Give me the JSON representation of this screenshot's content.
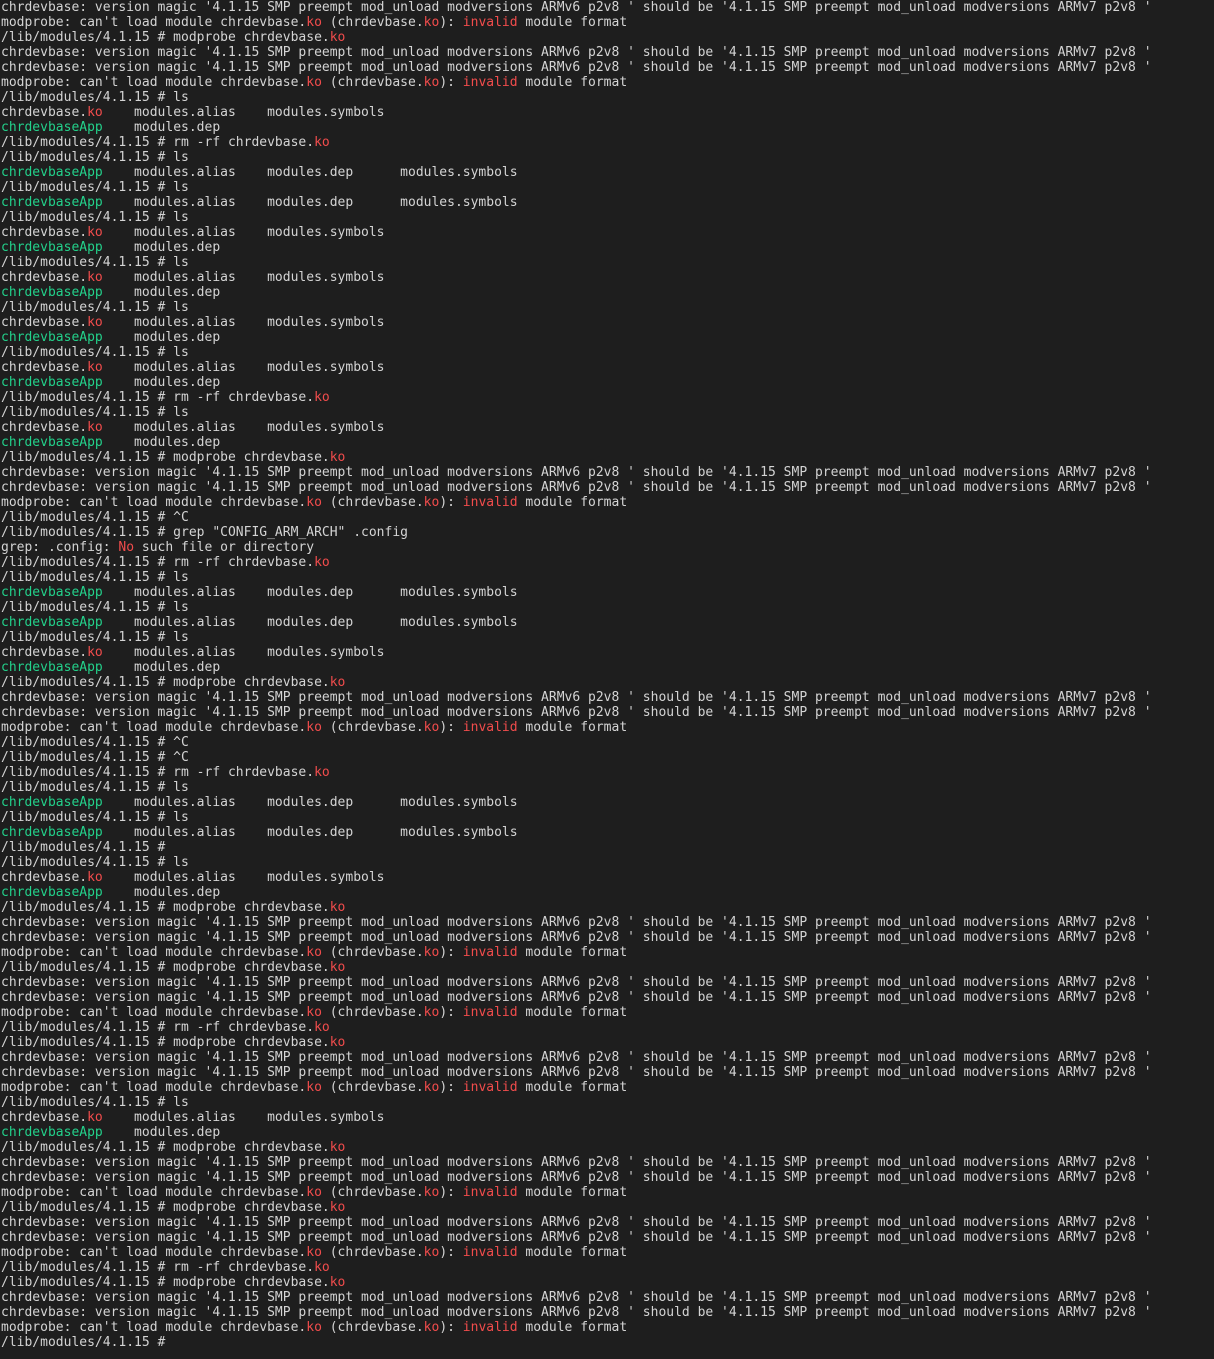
{
  "terminal": {
    "colors": {
      "background": "#1e1e1e",
      "foreground": "#d4d4d4",
      "ko_extension": "#f14c4c",
      "executable": "#23d18b",
      "error": "#f14c4c"
    },
    "lines": [
      [
        [
          "chrdevbase: version magic '4.1.15 SMP preempt mod_unload modversions ARMv6 p2v8 ' should be '4.1.15 SMP preempt mod_unload modversions ARMv7 p2v8 '",
          ""
        ]
      ],
      [
        [
          "modprobe: can't load module chrdevbase.",
          ""
        ],
        [
          "ko",
          "ko"
        ],
        [
          " (chrdevbase.",
          ""
        ],
        [
          "ko",
          "ko"
        ],
        [
          "): ",
          ""
        ],
        [
          "invalid",
          "err"
        ],
        [
          " module format",
          ""
        ]
      ],
      [
        [
          "/lib/modules/4.1.15 # modprobe chrdevbase.",
          ""
        ],
        [
          "ko",
          "ko"
        ]
      ],
      [
        [
          "chrdevbase: version magic '4.1.15 SMP preempt mod_unload modversions ARMv6 p2v8 ' should be '4.1.15 SMP preempt mod_unload modversions ARMv7 p2v8 '",
          ""
        ]
      ],
      [
        [
          "chrdevbase: version magic '4.1.15 SMP preempt mod_unload modversions ARMv6 p2v8 ' should be '4.1.15 SMP preempt mod_unload modversions ARMv7 p2v8 '",
          ""
        ]
      ],
      [
        [
          "modprobe: can't load module chrdevbase.",
          ""
        ],
        [
          "ko",
          "ko"
        ],
        [
          " (chrdevbase.",
          ""
        ],
        [
          "ko",
          "ko"
        ],
        [
          "): ",
          ""
        ],
        [
          "invalid",
          "err"
        ],
        [
          " module format",
          ""
        ]
      ],
      [
        [
          "/lib/modules/4.1.15 # ls",
          ""
        ]
      ],
      [
        [
          "chrdevbase.",
          ""
        ],
        [
          "ko",
          "ko"
        ],
        [
          "    modules.alias    modules.symbols",
          ""
        ]
      ],
      [
        [
          "chrdevbaseApp",
          "app"
        ],
        [
          "    modules.dep",
          ""
        ]
      ],
      [
        [
          "/lib/modules/4.1.15 # rm -rf chrdevbase.",
          ""
        ],
        [
          "ko",
          "ko"
        ]
      ],
      [
        [
          "/lib/modules/4.1.15 # ls",
          ""
        ]
      ],
      [
        [
          "chrdevbaseApp",
          "app"
        ],
        [
          "    modules.alias    modules.dep      modules.symbols",
          ""
        ]
      ],
      [
        [
          "/lib/modules/4.1.15 # ls",
          ""
        ]
      ],
      [
        [
          "chrdevbaseApp",
          "app"
        ],
        [
          "    modules.alias    modules.dep      modules.symbols",
          ""
        ]
      ],
      [
        [
          "/lib/modules/4.1.15 # ls",
          ""
        ]
      ],
      [
        [
          "chrdevbase.",
          ""
        ],
        [
          "ko",
          "ko"
        ],
        [
          "    modules.alias    modules.symbols",
          ""
        ]
      ],
      [
        [
          "chrdevbaseApp",
          "app"
        ],
        [
          "    modules.dep",
          ""
        ]
      ],
      [
        [
          "/lib/modules/4.1.15 # ls",
          ""
        ]
      ],
      [
        [
          "chrdevbase.",
          ""
        ],
        [
          "ko",
          "ko"
        ],
        [
          "    modules.alias    modules.symbols",
          ""
        ]
      ],
      [
        [
          "chrdevbaseApp",
          "app"
        ],
        [
          "    modules.dep",
          ""
        ]
      ],
      [
        [
          "/lib/modules/4.1.15 # ls",
          ""
        ]
      ],
      [
        [
          "chrdevbase.",
          ""
        ],
        [
          "ko",
          "ko"
        ],
        [
          "    modules.alias    modules.symbols",
          ""
        ]
      ],
      [
        [
          "chrdevbaseApp",
          "app"
        ],
        [
          "    modules.dep",
          ""
        ]
      ],
      [
        [
          "/lib/modules/4.1.15 # ls",
          ""
        ]
      ],
      [
        [
          "chrdevbase.",
          ""
        ],
        [
          "ko",
          "ko"
        ],
        [
          "    modules.alias    modules.symbols",
          ""
        ]
      ],
      [
        [
          "chrdevbaseApp",
          "app"
        ],
        [
          "    modules.dep",
          ""
        ]
      ],
      [
        [
          "/lib/modules/4.1.15 # rm -rf chrdevbase.",
          ""
        ],
        [
          "ko",
          "ko"
        ]
      ],
      [
        [
          "/lib/modules/4.1.15 # ls",
          ""
        ]
      ],
      [
        [
          "chrdevbase.",
          ""
        ],
        [
          "ko",
          "ko"
        ],
        [
          "    modules.alias    modules.symbols",
          ""
        ]
      ],
      [
        [
          "chrdevbaseApp",
          "app"
        ],
        [
          "    modules.dep",
          ""
        ]
      ],
      [
        [
          "/lib/modules/4.1.15 # modprobe chrdevbase.",
          ""
        ],
        [
          "ko",
          "ko"
        ]
      ],
      [
        [
          "chrdevbase: version magic '4.1.15 SMP preempt mod_unload modversions ARMv6 p2v8 ' should be '4.1.15 SMP preempt mod_unload modversions ARMv7 p2v8 '",
          ""
        ]
      ],
      [
        [
          "chrdevbase: version magic '4.1.15 SMP preempt mod_unload modversions ARMv6 p2v8 ' should be '4.1.15 SMP preempt mod_unload modversions ARMv7 p2v8 '",
          ""
        ]
      ],
      [
        [
          "modprobe: can't load module chrdevbase.",
          ""
        ],
        [
          "ko",
          "ko"
        ],
        [
          " (chrdevbase.",
          ""
        ],
        [
          "ko",
          "ko"
        ],
        [
          "): ",
          ""
        ],
        [
          "invalid",
          "err"
        ],
        [
          " module format",
          ""
        ]
      ],
      [
        [
          "/lib/modules/4.1.15 # ^C",
          ""
        ]
      ],
      [
        [
          "/lib/modules/4.1.15 # grep \"CONFIG_ARM_ARCH\" .config",
          ""
        ]
      ],
      [
        [
          "grep: .config: ",
          ""
        ],
        [
          "No",
          "err"
        ],
        [
          " such file or directory",
          ""
        ]
      ],
      [
        [
          "/lib/modules/4.1.15 # rm -rf chrdevbase.",
          ""
        ],
        [
          "ko",
          "ko"
        ]
      ],
      [
        [
          "/lib/modules/4.1.15 # ls",
          ""
        ]
      ],
      [
        [
          "chrdevbaseApp",
          "app"
        ],
        [
          "    modules.alias    modules.dep      modules.symbols",
          ""
        ]
      ],
      [
        [
          "/lib/modules/4.1.15 # ls",
          ""
        ]
      ],
      [
        [
          "chrdevbaseApp",
          "app"
        ],
        [
          "    modules.alias    modules.dep      modules.symbols",
          ""
        ]
      ],
      [
        [
          "/lib/modules/4.1.15 # ls",
          ""
        ]
      ],
      [
        [
          "chrdevbase.",
          ""
        ],
        [
          "ko",
          "ko"
        ],
        [
          "    modules.alias    modules.symbols",
          ""
        ]
      ],
      [
        [
          "chrdevbaseApp",
          "app"
        ],
        [
          "    modules.dep",
          ""
        ]
      ],
      [
        [
          "/lib/modules/4.1.15 # modprobe chrdevbase.",
          ""
        ],
        [
          "ko",
          "ko"
        ]
      ],
      [
        [
          "chrdevbase: version magic '4.1.15 SMP preempt mod_unload modversions ARMv6 p2v8 ' should be '4.1.15 SMP preempt mod_unload modversions ARMv7 p2v8 '",
          ""
        ]
      ],
      [
        [
          "chrdevbase: version magic '4.1.15 SMP preempt mod_unload modversions ARMv6 p2v8 ' should be '4.1.15 SMP preempt mod_unload modversions ARMv7 p2v8 '",
          ""
        ]
      ],
      [
        [
          "modprobe: can't load module chrdevbase.",
          ""
        ],
        [
          "ko",
          "ko"
        ],
        [
          " (chrdevbase.",
          ""
        ],
        [
          "ko",
          "ko"
        ],
        [
          "): ",
          ""
        ],
        [
          "invalid",
          "err"
        ],
        [
          " module format",
          ""
        ]
      ],
      [
        [
          "/lib/modules/4.1.15 # ^C",
          ""
        ]
      ],
      [
        [
          "/lib/modules/4.1.15 # ^C",
          ""
        ]
      ],
      [
        [
          "/lib/modules/4.1.15 # rm -rf chrdevbase.",
          ""
        ],
        [
          "ko",
          "ko"
        ]
      ],
      [
        [
          "/lib/modules/4.1.15 # ls",
          ""
        ]
      ],
      [
        [
          "chrdevbaseApp",
          "app"
        ],
        [
          "    modules.alias    modules.dep      modules.symbols",
          ""
        ]
      ],
      [
        [
          "/lib/modules/4.1.15 # ls",
          ""
        ]
      ],
      [
        [
          "chrdevbaseApp",
          "app"
        ],
        [
          "    modules.alias    modules.dep      modules.symbols",
          ""
        ]
      ],
      [
        [
          "/lib/modules/4.1.15 #",
          ""
        ]
      ],
      [
        [
          "/lib/modules/4.1.15 # ls",
          ""
        ]
      ],
      [
        [
          "chrdevbase.",
          ""
        ],
        [
          "ko",
          "ko"
        ],
        [
          "    modules.alias    modules.symbols",
          ""
        ]
      ],
      [
        [
          "chrdevbaseApp",
          "app"
        ],
        [
          "    modules.dep",
          ""
        ]
      ],
      [
        [
          "/lib/modules/4.1.15 # modprobe chrdevbase.",
          ""
        ],
        [
          "ko",
          "ko"
        ]
      ],
      [
        [
          "chrdevbase: version magic '4.1.15 SMP preempt mod_unload modversions ARMv6 p2v8 ' should be '4.1.15 SMP preempt mod_unload modversions ARMv7 p2v8 '",
          ""
        ]
      ],
      [
        [
          "chrdevbase: version magic '4.1.15 SMP preempt mod_unload modversions ARMv6 p2v8 ' should be '4.1.15 SMP preempt mod_unload modversions ARMv7 p2v8 '",
          ""
        ]
      ],
      [
        [
          "modprobe: can't load module chrdevbase.",
          ""
        ],
        [
          "ko",
          "ko"
        ],
        [
          " (chrdevbase.",
          ""
        ],
        [
          "ko",
          "ko"
        ],
        [
          "): ",
          ""
        ],
        [
          "invalid",
          "err"
        ],
        [
          " module format",
          ""
        ]
      ],
      [
        [
          "/lib/modules/4.1.15 # modprobe chrdevbase.",
          ""
        ],
        [
          "ko",
          "ko"
        ]
      ],
      [
        [
          "chrdevbase: version magic '4.1.15 SMP preempt mod_unload modversions ARMv6 p2v8 ' should be '4.1.15 SMP preempt mod_unload modversions ARMv7 p2v8 '",
          ""
        ]
      ],
      [
        [
          "chrdevbase: version magic '4.1.15 SMP preempt mod_unload modversions ARMv6 p2v8 ' should be '4.1.15 SMP preempt mod_unload modversions ARMv7 p2v8 '",
          ""
        ]
      ],
      [
        [
          "modprobe: can't load module chrdevbase.",
          ""
        ],
        [
          "ko",
          "ko"
        ],
        [
          " (chrdevbase.",
          ""
        ],
        [
          "ko",
          "ko"
        ],
        [
          "): ",
          ""
        ],
        [
          "invalid",
          "err"
        ],
        [
          " module format",
          ""
        ]
      ],
      [
        [
          "/lib/modules/4.1.15 # rm -rf chrdevbase.",
          ""
        ],
        [
          "ko",
          "ko"
        ]
      ],
      [
        [
          "/lib/modules/4.1.15 # modprobe chrdevbase.",
          ""
        ],
        [
          "ko",
          "ko"
        ]
      ],
      [
        [
          "chrdevbase: version magic '4.1.15 SMP preempt mod_unload modversions ARMv6 p2v8 ' should be '4.1.15 SMP preempt mod_unload modversions ARMv7 p2v8 '",
          ""
        ]
      ],
      [
        [
          "chrdevbase: version magic '4.1.15 SMP preempt mod_unload modversions ARMv6 p2v8 ' should be '4.1.15 SMP preempt mod_unload modversions ARMv7 p2v8 '",
          ""
        ]
      ],
      [
        [
          "modprobe: can't load module chrdevbase.",
          ""
        ],
        [
          "ko",
          "ko"
        ],
        [
          " (chrdevbase.",
          ""
        ],
        [
          "ko",
          "ko"
        ],
        [
          "): ",
          ""
        ],
        [
          "invalid",
          "err"
        ],
        [
          " module format",
          ""
        ]
      ],
      [
        [
          "/lib/modules/4.1.15 # ls",
          ""
        ]
      ],
      [
        [
          "chrdevbase.",
          ""
        ],
        [
          "ko",
          "ko"
        ],
        [
          "    modules.alias    modules.symbols",
          ""
        ]
      ],
      [
        [
          "chrdevbaseApp",
          "app"
        ],
        [
          "    modules.dep",
          ""
        ]
      ],
      [
        [
          "/lib/modules/4.1.15 # modprobe chrdevbase.",
          ""
        ],
        [
          "ko",
          "ko"
        ]
      ],
      [
        [
          "chrdevbase: version magic '4.1.15 SMP preempt mod_unload modversions ARMv6 p2v8 ' should be '4.1.15 SMP preempt mod_unload modversions ARMv7 p2v8 '",
          ""
        ]
      ],
      [
        [
          "chrdevbase: version magic '4.1.15 SMP preempt mod_unload modversions ARMv6 p2v8 ' should be '4.1.15 SMP preempt mod_unload modversions ARMv7 p2v8 '",
          ""
        ]
      ],
      [
        [
          "modprobe: can't load module chrdevbase.",
          ""
        ],
        [
          "ko",
          "ko"
        ],
        [
          " (chrdevbase.",
          ""
        ],
        [
          "ko",
          "ko"
        ],
        [
          "): ",
          ""
        ],
        [
          "invalid",
          "err"
        ],
        [
          " module format",
          ""
        ]
      ],
      [
        [
          "/lib/modules/4.1.15 # modprobe chrdevbase.",
          ""
        ],
        [
          "ko",
          "ko"
        ]
      ],
      [
        [
          "chrdevbase: version magic '4.1.15 SMP preempt mod_unload modversions ARMv6 p2v8 ' should be '4.1.15 SMP preempt mod_unload modversions ARMv7 p2v8 '",
          ""
        ]
      ],
      [
        [
          "chrdevbase: version magic '4.1.15 SMP preempt mod_unload modversions ARMv6 p2v8 ' should be '4.1.15 SMP preempt mod_unload modversions ARMv7 p2v8 '",
          ""
        ]
      ],
      [
        [
          "modprobe: can't load module chrdevbase.",
          ""
        ],
        [
          "ko",
          "ko"
        ],
        [
          " (chrdevbase.",
          ""
        ],
        [
          "ko",
          "ko"
        ],
        [
          "): ",
          ""
        ],
        [
          "invalid",
          "err"
        ],
        [
          " module format",
          ""
        ]
      ],
      [
        [
          "/lib/modules/4.1.15 # rm -rf chrdevbase.",
          ""
        ],
        [
          "ko",
          "ko"
        ]
      ],
      [
        [
          "/lib/modules/4.1.15 # modprobe chrdevbase.",
          ""
        ],
        [
          "ko",
          "ko"
        ]
      ],
      [
        [
          "chrdevbase: version magic '4.1.15 SMP preempt mod_unload modversions ARMv6 p2v8 ' should be '4.1.15 SMP preempt mod_unload modversions ARMv7 p2v8 '",
          ""
        ]
      ],
      [
        [
          "chrdevbase: version magic '4.1.15 SMP preempt mod_unload modversions ARMv6 p2v8 ' should be '4.1.15 SMP preempt mod_unload modversions ARMv7 p2v8 '",
          ""
        ]
      ],
      [
        [
          "modprobe: can't load module chrdevbase.",
          ""
        ],
        [
          "ko",
          "ko"
        ],
        [
          " (chrdevbase.",
          ""
        ],
        [
          "ko",
          "ko"
        ],
        [
          "): ",
          ""
        ],
        [
          "invalid",
          "err"
        ],
        [
          " module format",
          ""
        ]
      ],
      [
        [
          "/lib/modules/4.1.15 # ",
          ""
        ]
      ]
    ]
  }
}
